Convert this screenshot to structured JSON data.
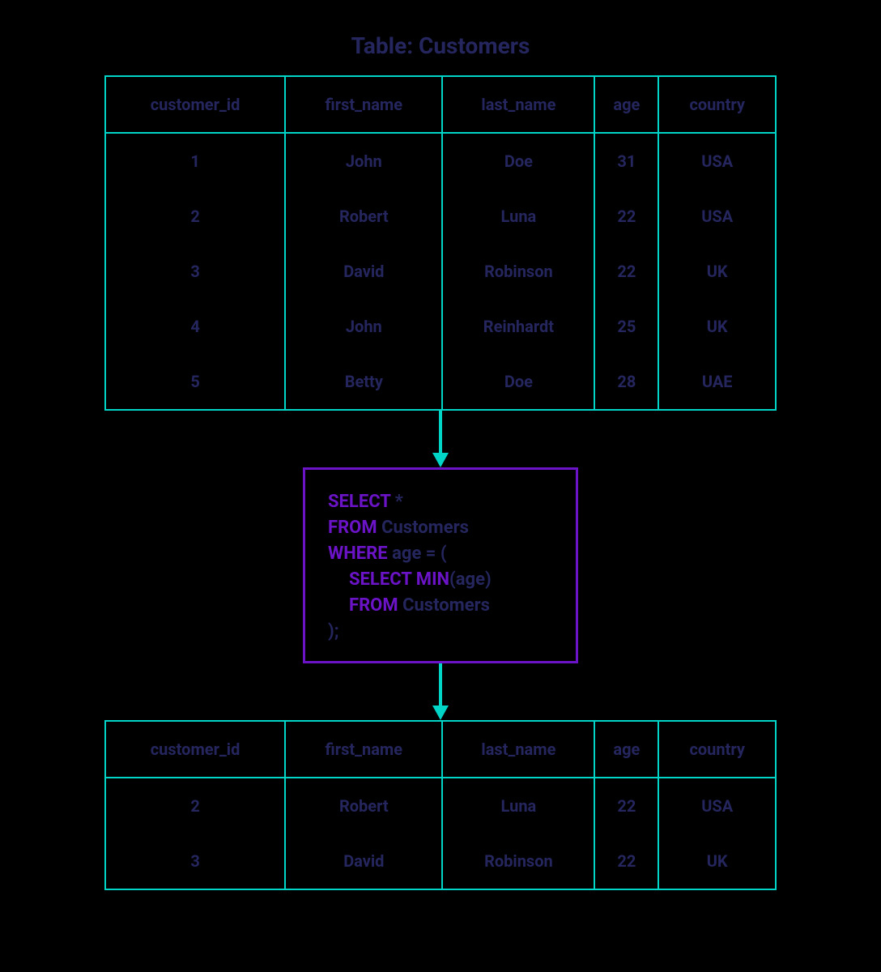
{
  "title": "Table: Customers",
  "columns": [
    "customer_id",
    "first_name",
    "last_name",
    "age",
    "country"
  ],
  "source_rows": [
    {
      "customer_id": "1",
      "first_name": "John",
      "last_name": "Doe",
      "age": "31",
      "country": "USA"
    },
    {
      "customer_id": "2",
      "first_name": "Robert",
      "last_name": "Luna",
      "age": "22",
      "country": "USA"
    },
    {
      "customer_id": "3",
      "first_name": "David",
      "last_name": "Robinson",
      "age": "22",
      "country": "UK"
    },
    {
      "customer_id": "4",
      "first_name": "John",
      "last_name": "Reinhardt",
      "age": "25",
      "country": "UK"
    },
    {
      "customer_id": "5",
      "first_name": "Betty",
      "last_name": "Doe",
      "age": "28",
      "country": "UAE"
    }
  ],
  "result_rows": [
    {
      "customer_id": "2",
      "first_name": "Robert",
      "last_name": "Luna",
      "age": "22",
      "country": "USA"
    },
    {
      "customer_id": "3",
      "first_name": "David",
      "last_name": "Robinson",
      "age": "22",
      "country": "UK"
    }
  ],
  "sql": {
    "tokens": [
      [
        {
          "t": "SELECT",
          "kw": true
        },
        {
          "t": " *",
          "kw": false
        }
      ],
      [
        {
          "t": "FROM",
          "kw": true
        },
        {
          "t": " Customers",
          "kw": false
        }
      ],
      [
        {
          "t": "WHERE",
          "kw": true
        },
        {
          "t": " age = (",
          "kw": false
        }
      ],
      [
        {
          "t": "SELECT MIN",
          "kw": true,
          "indent": 1
        },
        {
          "t": "(age)",
          "kw": false
        }
      ],
      [
        {
          "t": "FROM",
          "kw": true,
          "indent": 1
        },
        {
          "t": " Customers",
          "kw": false
        }
      ],
      [
        {
          "t": ");",
          "kw": false
        }
      ]
    ]
  },
  "colors": {
    "background": "#000000",
    "text": "#25265E",
    "table_border": "#00D5C7",
    "sql_border": "#6B14C7",
    "keyword": "#6B14C7",
    "arrow": "#00D5C7"
  }
}
